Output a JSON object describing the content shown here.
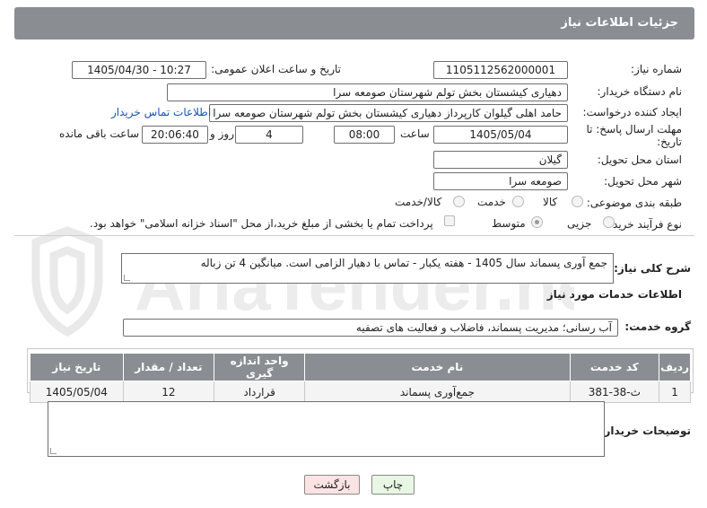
{
  "header": {
    "title": "جزئیات اطلاعات نیاز"
  },
  "form": {
    "need_number": {
      "label": "شماره نیاز:",
      "value": "1105112562000001"
    },
    "announce_datetime": {
      "label": "تاریخ و ساعت اعلان عمومی:",
      "value": "1405/04/30 - 10:27"
    },
    "buyer_org": {
      "label": "نام دستگاه خریدار:",
      "value": "دهیاری کیشستان بخش تولم شهرستان صومعه سرا"
    },
    "requester": {
      "label": "ایجاد کننده درخواست:",
      "value": "حامد اهلی گیلوان کارپرداز دهیاری کیشستان بخش تولم شهرستان صومعه سرا",
      "contact_link": "اطلاعات تماس خریدار"
    },
    "deadline": {
      "label_line1": "مهلت ارسال پاسخ: تا",
      "label_line2": "تاریخ:",
      "date": "1405/05/04",
      "time_label": "ساعت",
      "time": "08:00",
      "days_value": "4",
      "days_label": "روز و",
      "remaining_value": "20:06:40",
      "remaining_label": "ساعت باقی مانده"
    },
    "province": {
      "label": "استان محل تحویل:",
      "value": "گیلان"
    },
    "city": {
      "label": "شهر محل تحویل:",
      "value": "صومعه سرا"
    },
    "category": {
      "label": "طبقه بندی موضوعی:",
      "options": [
        "کالا",
        "خدمت",
        "کالا/خدمت"
      ],
      "selected": "خدمت"
    },
    "process_type": {
      "label": "نوع فرآیند خرید :",
      "options": [
        "جزیی",
        "متوسط"
      ],
      "selected": "متوسط",
      "payment_note": "پرداخت تمام یا بخشی از مبلغ خرید،از محل \"اسناد خزانه اسلامی\" خواهد بود."
    }
  },
  "summary": {
    "label": "شرح کلی نیاز:",
    "value": "جمع آوری پسماند سال 1405 - هفته یکبار - تماس با دهیار الزامی است. میانگین 4 تن زباله"
  },
  "services": {
    "section_title": "اطلاعات خدمات مورد نیاز",
    "group_label": "گروه خدمت:",
    "group_value": "آب رسانی؛ مدیریت پسماند، فاضلاب و فعالیت های تصفیه",
    "table": {
      "headers": [
        "ردیف",
        "کد خدمت",
        "نام خدمت",
        "واحد اندازه گیری",
        "تعداد / مقدار",
        "تاریخ نیاز"
      ],
      "rows": [
        [
          "1",
          "ث-38-381",
          "جمع‌آوری پسماند",
          "قرارداد",
          "12",
          "1405/05/04"
        ]
      ]
    }
  },
  "buyer_notes": {
    "label": "توضیحات خریدار:",
    "value": ""
  },
  "buttons": {
    "print": "چاپ",
    "back": "بازگشت"
  },
  "watermark": {
    "text": "AriaTender.net"
  },
  "colors": {
    "header_bg": "#8a8e92",
    "link": "#1a55b3",
    "back_button_bg": "#fbe3e3",
    "print_button_bg": "#e8f6e3"
  }
}
